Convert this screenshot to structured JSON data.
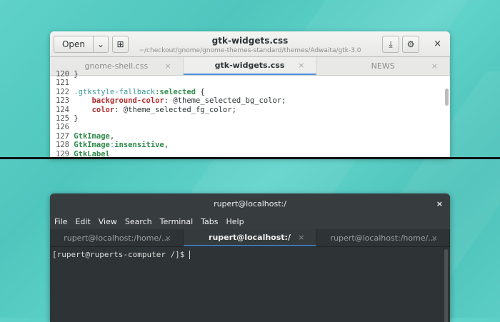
{
  "editor": {
    "open_label": "Open",
    "title": "gtk-widgets.css",
    "path": "~/checkout/gnome/gnome-themes-standard/themes/Adwaita/gtk-3.0",
    "tabs": [
      {
        "label": "gnome-shell.css"
      },
      {
        "label": "gtk-widgets.css"
      },
      {
        "label": "NEWS"
      }
    ],
    "lines": [
      {
        "n": "120",
        "parts": [
          [
            "",
            "}"
          ]
        ]
      },
      {
        "n": "121",
        "parts": []
      },
      {
        "n": "122",
        "parts": [
          [
            "c",
            ".gtkstyle-fallback"
          ],
          [
            "g",
            ":selected"
          ],
          [
            "",
            " {"
          ]
        ]
      },
      {
        "n": "123",
        "parts": [
          [
            "",
            "    "
          ],
          [
            "r",
            "background-color"
          ],
          [
            "",
            ": @theme_selected_bg_color;"
          ]
        ]
      },
      {
        "n": "124",
        "parts": [
          [
            "",
            "    "
          ],
          [
            "r",
            "color"
          ],
          [
            "",
            ": @theme_selected_fg_color;"
          ]
        ]
      },
      {
        "n": "125",
        "parts": [
          [
            "",
            "}"
          ]
        ]
      },
      {
        "n": "126",
        "parts": []
      },
      {
        "n": "127",
        "parts": [
          [
            "g",
            "GtkImage"
          ],
          [
            "",
            ","
          ]
        ]
      },
      {
        "n": "128",
        "parts": [
          [
            "g",
            "GtkImage"
          ],
          [
            "c",
            ":"
          ],
          [
            "g",
            "insensitive"
          ],
          [
            "",
            ","
          ]
        ]
      },
      {
        "n": "129",
        "parts": [
          [
            "g",
            "GtkLabel"
          ]
        ]
      }
    ]
  },
  "terminal": {
    "title": "rupert@localhost:/",
    "menu": [
      "File",
      "Edit",
      "View",
      "Search",
      "Terminal",
      "Tabs",
      "Help"
    ],
    "tabs": [
      {
        "label": "rupert@localhost:/home/..."
      },
      {
        "label": "rupert@localhost:/"
      },
      {
        "label": "rupert@localhost:/home/..."
      }
    ],
    "prompt": "[rupert@ruperts-computer /]$ "
  }
}
